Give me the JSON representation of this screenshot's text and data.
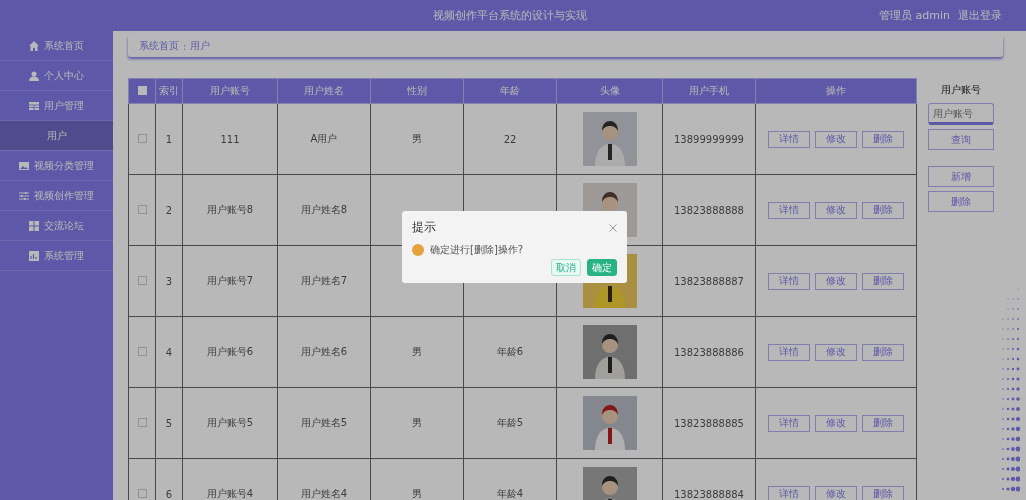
{
  "header": {
    "title": "视频创作平台系统的设计与实现",
    "user": "管理员 admin",
    "logout": "退出登录"
  },
  "sidebar": {
    "items": [
      {
        "label": "系统首页",
        "kind": "menu",
        "selected": false
      },
      {
        "label": "个人中心",
        "kind": "menu",
        "selected": false
      },
      {
        "label": "用户管理",
        "kind": "menu",
        "selected": false
      },
      {
        "label": "用户",
        "kind": "submenu",
        "selected": true
      },
      {
        "label": "视频分类管理",
        "kind": "menu",
        "selected": false
      },
      {
        "label": "视频创作管理",
        "kind": "menu",
        "selected": false
      },
      {
        "label": "交流论坛",
        "kind": "menu",
        "selected": false
      },
      {
        "label": "系统管理",
        "kind": "menu",
        "selected": false
      }
    ]
  },
  "breadcrumb": [
    "系统首页",
    ":",
    "用户"
  ],
  "table": {
    "columns": [
      "索引",
      "用户账号",
      "用户姓名",
      "性别",
      "年龄",
      "头像",
      "用户手机",
      "操作"
    ],
    "header_checked": false,
    "rows": [
      {
        "index": "1",
        "account": "111",
        "name": "A用户",
        "gender": "男",
        "age": "22",
        "phone": "13899999999",
        "buttons": [
          "详情",
          "修改",
          "删除"
        ],
        "checked": false
      },
      {
        "index": "2",
        "account": "用户账号8",
        "name": "用户姓名8",
        "phone": "13823888888",
        "buttons": [
          "详情",
          "修改",
          "删除"
        ],
        "checked": false
      },
      {
        "index": "3",
        "account": "用户账号7",
        "name": "用户姓名7",
        "phone": "13823888887",
        "buttons": [
          "详情",
          "修改",
          "删除"
        ],
        "checked": false
      },
      {
        "index": "4",
        "account": "用户账号6",
        "name": "用户姓名6",
        "gender": "男",
        "age": "年龄6",
        "phone": "13823888886",
        "buttons": [
          "详情",
          "修改",
          "删除"
        ],
        "checked": false
      },
      {
        "index": "5",
        "account": "用户账号5",
        "name": "用户姓名5",
        "gender": "男",
        "age": "年龄5",
        "phone": "13823888885",
        "buttons": [
          "详情",
          "修改",
          "删除"
        ],
        "checked": false
      },
      {
        "index": "6",
        "account": "用户账号4",
        "name": "用户姓名4",
        "gender": "男",
        "age": "年龄4",
        "phone": "13823888884",
        "buttons": [
          "详情",
          "修改",
          "删除"
        ],
        "checked": false
      }
    ]
  },
  "search_panel": {
    "label": "用户账号",
    "placeholder": "用户账号",
    "buttons": [
      {
        "label": "查询",
        "kind": "search"
      },
      {
        "label": "新增",
        "kind": "action"
      },
      {
        "label": "删除",
        "kind": "action"
      }
    ]
  },
  "dialog": {
    "title": "提示",
    "message": "确定进行[删除]操作?",
    "buttons": [
      {
        "label": "取消",
        "kind": "secondary"
      },
      {
        "label": "确定",
        "kind": "primary"
      }
    ]
  }
}
